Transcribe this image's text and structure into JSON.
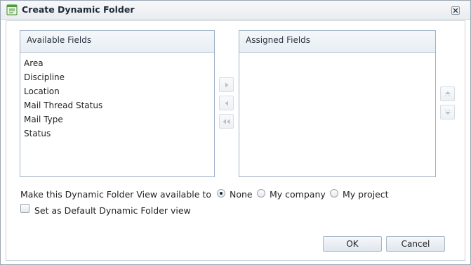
{
  "dialog": {
    "title": "Create Dynamic Folder",
    "title_icon": "form-window-icon",
    "close_icon": "close-icon"
  },
  "available": {
    "header": "Available Fields",
    "items": [
      "Area",
      "Discipline",
      "Location",
      "Mail Thread Status",
      "Mail Type",
      "Status"
    ]
  },
  "assigned": {
    "header": "Assigned Fields",
    "items": []
  },
  "move_buttons": {
    "add_icon": "move-right-icon",
    "remove_icon": "move-left-icon",
    "remove_all_icon": "move-all-left-icon",
    "up_icon": "move-up-icon",
    "down_icon": "move-down-icon"
  },
  "visibility": {
    "label": "Make this Dynamic Folder View available to",
    "options": [
      "None",
      "My company",
      "My project"
    ],
    "selected": "None"
  },
  "default_view": {
    "label": "Set as Default Dynamic Folder view",
    "checked": false
  },
  "buttons": {
    "ok": "OK",
    "cancel": "Cancel"
  }
}
